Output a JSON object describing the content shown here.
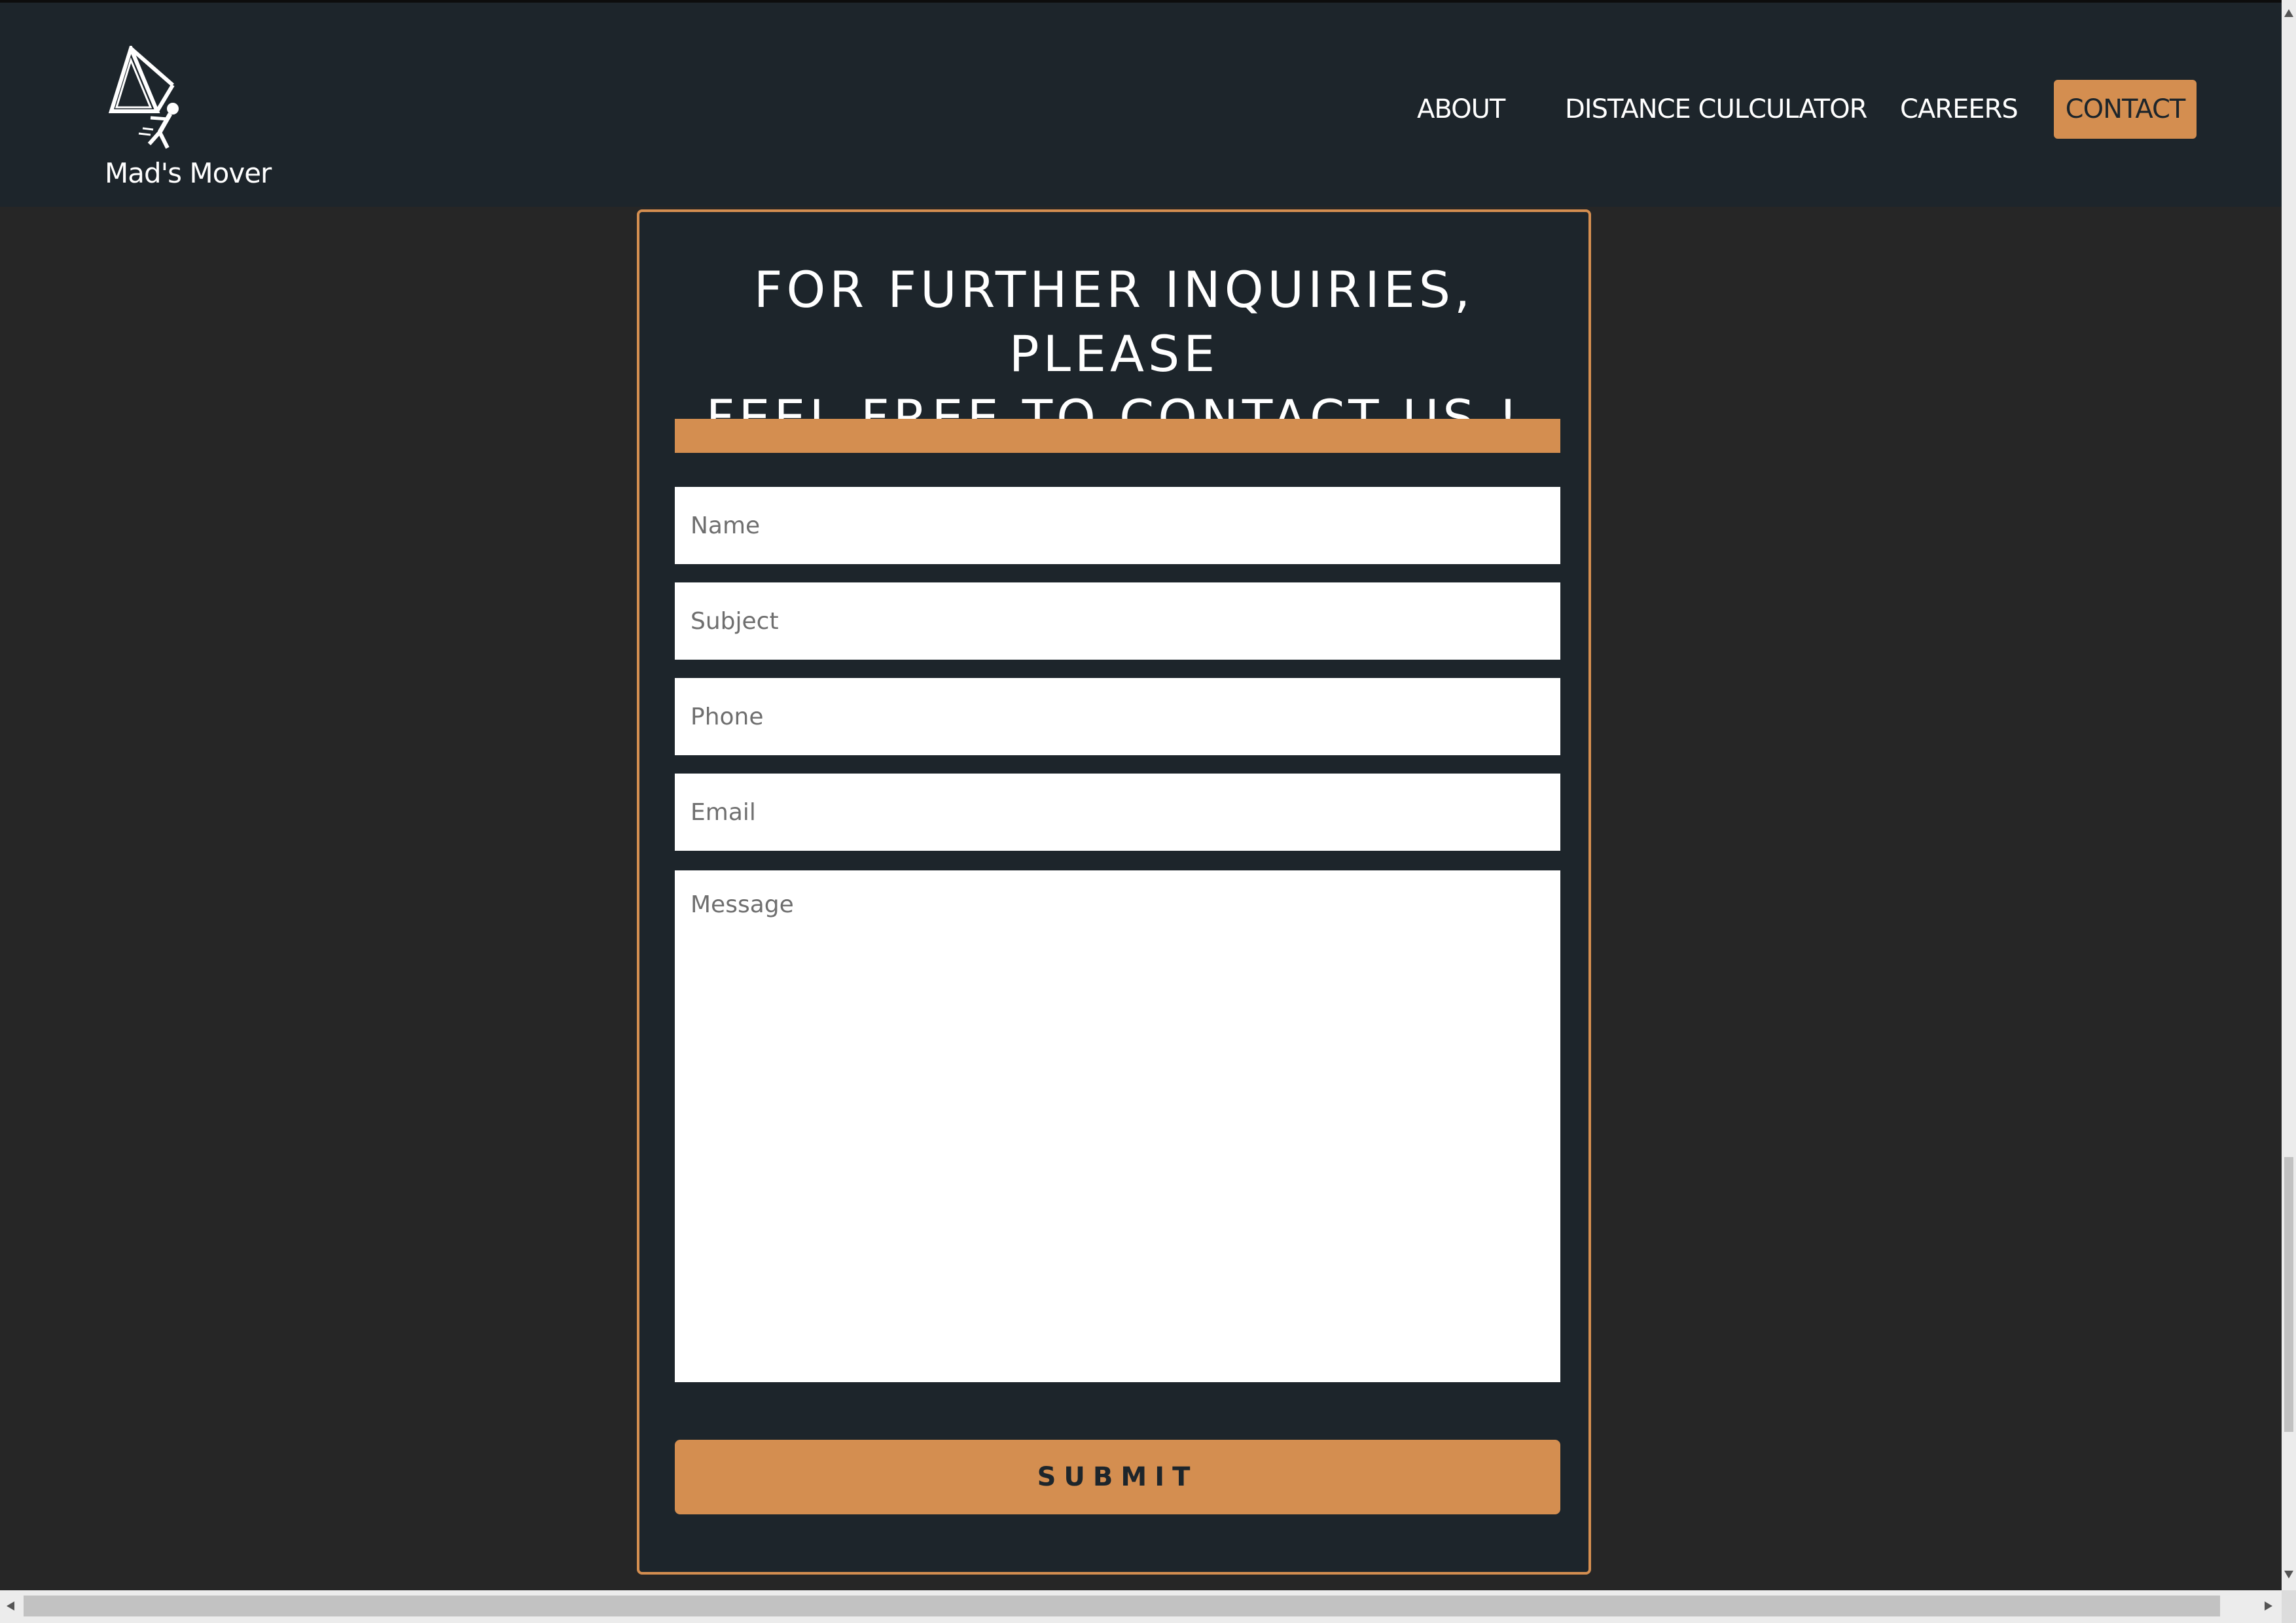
{
  "brand": {
    "name": "Mad's Mover",
    "logo_icon": "mover-logo-icon"
  },
  "nav": {
    "items": [
      {
        "label": "ABOUT"
      },
      {
        "label": "DISTANCE CULCULATOR"
      },
      {
        "label": "CAREERS"
      },
      {
        "label": "CONTACT",
        "active": true
      }
    ]
  },
  "contact_form": {
    "heading_line1": "FOR FURTHER INQUIRIES, PLEASE",
    "heading_line2": "FEEL FREE TO CONTACT US !",
    "fields": {
      "name": {
        "placeholder": "Name",
        "value": ""
      },
      "subject": {
        "placeholder": "Subject",
        "value": ""
      },
      "phone": {
        "placeholder": "Phone",
        "value": ""
      },
      "email": {
        "placeholder": "Email",
        "value": ""
      },
      "message": {
        "placeholder": "Message",
        "value": ""
      }
    },
    "submit_label": "SUBMIT"
  },
  "colors": {
    "accent": "#d48e50",
    "navbar_bg": "#1d252b",
    "page_bg": "#262626",
    "text_light": "#ffffff"
  }
}
